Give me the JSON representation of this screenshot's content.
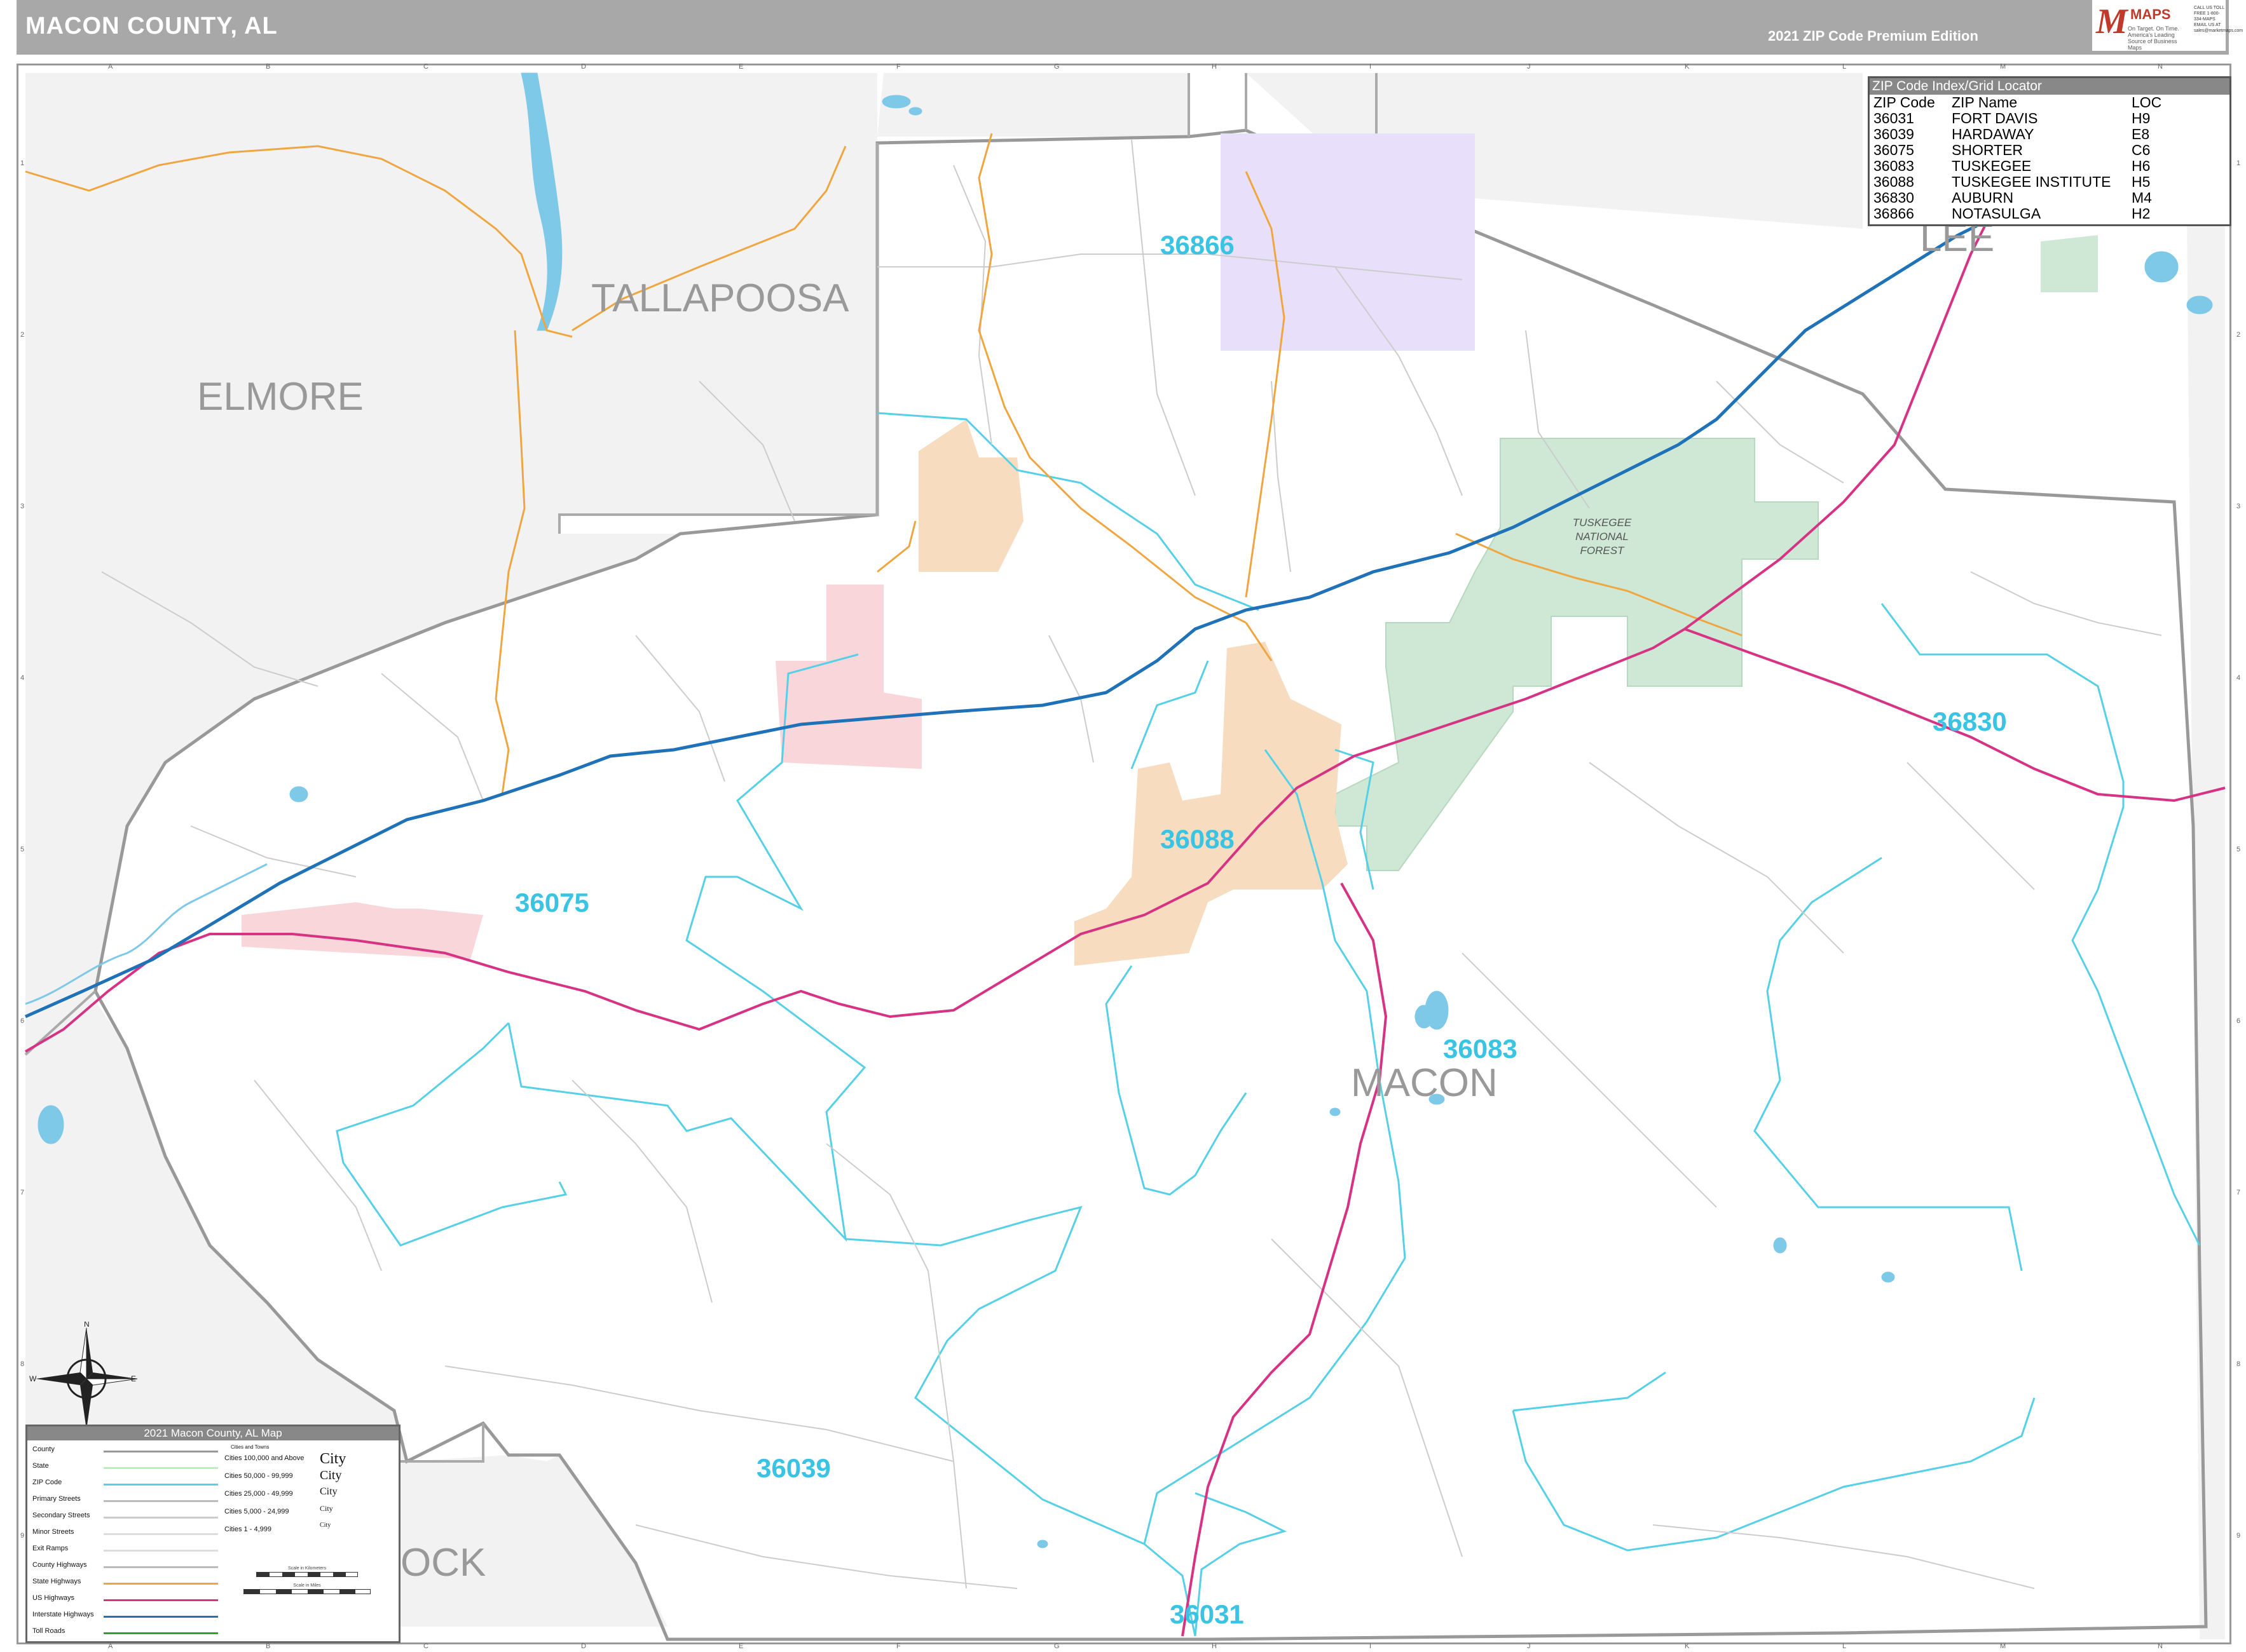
{
  "header": {
    "title": "MACON COUNTY, AL",
    "edition": "2021 ZIP Code Premium Edition",
    "logo_name": "Market",
    "logo_maps": "MAPS",
    "logo_tagline": "On Target. On Time. America's Leading Source of Business Maps",
    "logo_contact": "CALL US TOLL FREE 1-800-334-MAPS EMAIL US AT sales@marketmaps.com"
  },
  "grid": {
    "columns": [
      "A",
      "B",
      "C",
      "D",
      "E",
      "F",
      "G",
      "H",
      "I",
      "J",
      "K",
      "L",
      "M",
      "N"
    ],
    "rows": [
      "1",
      "2",
      "3",
      "4",
      "5",
      "6",
      "7",
      "8",
      "9"
    ]
  },
  "counties": {
    "tallapoosa": "TALLAPOOSA",
    "elmore": "ELMORE",
    "lee": "LEE",
    "macon": "MACON",
    "bullock": "OCK"
  },
  "zip_labels": {
    "z36866": "36866",
    "z36075": "36075",
    "z36088": "36088",
    "z36830": "36830",
    "z36083": "36083",
    "z36039": "36039",
    "z36031": "36031"
  },
  "forest": {
    "line1": "TUSKEGEE",
    "line2": "NATIONAL",
    "line3": "FOREST"
  },
  "zip_index": {
    "caption": "ZIP Code Index/Grid Locator",
    "headers": [
      "ZIP Code",
      "ZIP Name",
      "LOC"
    ],
    "rows": [
      [
        "36031",
        "FORT DAVIS",
        "H9"
      ],
      [
        "36039",
        "HARDAWAY",
        "E8"
      ],
      [
        "36075",
        "SHORTER",
        "C6"
      ],
      [
        "36083",
        "TUSKEGEE",
        "H6"
      ],
      [
        "36088",
        "TUSKEGEE INSTITUTE",
        "H5"
      ],
      [
        "36830",
        "AUBURN",
        "M4"
      ],
      [
        "36866",
        "NOTASULGA",
        "H2"
      ]
    ]
  },
  "legend": {
    "caption": "2021 Macon County, AL Map",
    "items": [
      {
        "label": "County",
        "color": "#999999"
      },
      {
        "label": "State",
        "color": "#b9f0b9"
      },
      {
        "label": "ZIP Code",
        "color": "#55d0e6"
      },
      {
        "label": "Primary Streets",
        "color": "#bbbbbb"
      },
      {
        "label": "Secondary Streets",
        "color": "#cccccc"
      },
      {
        "label": "Minor Streets",
        "color": "#dddddd"
      },
      {
        "label": "Exit Ramps",
        "color": "#dddddd"
      },
      {
        "label": "County Highways",
        "color": "#bbbbbb"
      },
      {
        "label": "State Highways",
        "color": "#f0a640"
      },
      {
        "label": "US Highways",
        "color": "#d63384"
      },
      {
        "label": "Interstate Highways",
        "color": "#1f72b8"
      },
      {
        "label": "Toll Roads",
        "color": "#2aa52a"
      }
    ],
    "cities_title": "Cities and Towns",
    "cities": [
      {
        "label": "Cities 100,000 and Above",
        "sample": "City"
      },
      {
        "label": "Cities 50,000 - 99,999",
        "sample": "City"
      },
      {
        "label": "Cities 25,000 - 49,999",
        "sample": "City"
      },
      {
        "label": "Cities 5,000 - 24,999",
        "sample": "City"
      },
      {
        "label": "Cities 1 - 4,999",
        "sample": "City"
      }
    ],
    "scale_km": "Scale in Kilometers",
    "scale_mi": "Scale in Miles"
  },
  "compass": {
    "n": "N",
    "s": "S",
    "e": "E",
    "w": "W"
  },
  "colors": {
    "outside": "#f2f2f2",
    "county_line": "#999999",
    "zip_line": "#55d0e6",
    "zip_label": "#3bc3e3",
    "interstate": "#1f72b8",
    "us_highway": "#d63384",
    "state_highway": "#f0a640",
    "water": "#7ec8e8",
    "forest": "#cfe8d5",
    "zip36866_fill": "#e8e0fb",
    "tuskegee_fill": "#f7dcc0",
    "pink_fill": "#f9d6da"
  }
}
